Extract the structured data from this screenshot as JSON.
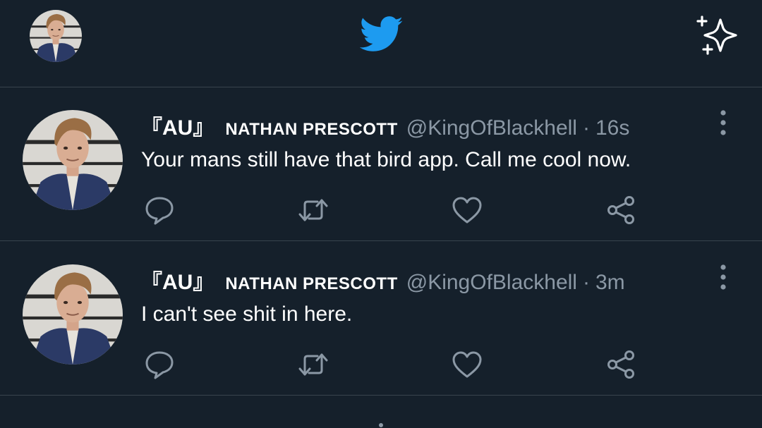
{
  "header": {
    "avatar_icon": "profile-avatar",
    "logo_icon": "twitter-bird-icon",
    "logo_color": "#1d9bf0",
    "sparkle_icon": "top-tweets-sparkle-icon"
  },
  "tweets": [
    {
      "name_prefix": "『AU』",
      "name": "NATHAN PRESCOTT",
      "handle": "@KingOfBlackhell",
      "separator": "·",
      "time": "16s",
      "text": "Your mans still have that bird app. Call me cool now."
    },
    {
      "name_prefix": "『AU』",
      "name": "NATHAN PRESCOTT",
      "handle": "@KingOfBlackhell",
      "separator": "·",
      "time": "3m",
      "text": "I can't see shit in here."
    }
  ],
  "actions": [
    "reply-icon",
    "retweet-icon",
    "like-icon",
    "share-icon"
  ],
  "colors": {
    "background": "#15202b",
    "divider": "#38444d",
    "secondary_text": "#8b98a5",
    "accent": "#1d9bf0"
  }
}
